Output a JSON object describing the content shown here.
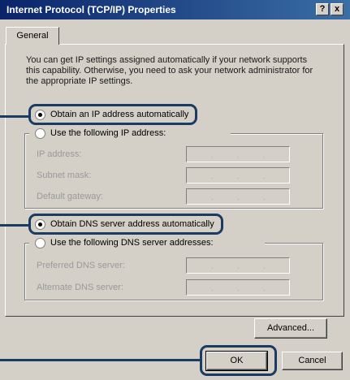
{
  "window": {
    "title": "Internet Protocol (TCP/IP) Properties",
    "help_button": "?",
    "close_button": "x"
  },
  "tab": {
    "label": "General"
  },
  "description": "You can get IP settings assigned automatically if your network supports this capability. Otherwise, you need to ask your network administrator for the appropriate IP settings.",
  "ip_group": {
    "auto_label": "Obtain an IP address automatically",
    "manual_label": "Use the following IP address:",
    "selected": "auto",
    "fields": [
      {
        "label": "IP address:"
      },
      {
        "label": "Subnet mask:"
      },
      {
        "label": "Default gateway:"
      }
    ]
  },
  "dns_group": {
    "auto_label": "Obtain DNS server address automatically",
    "manual_label": "Use the following DNS server addresses:",
    "selected": "auto",
    "fields": [
      {
        "label": "Preferred DNS server:"
      },
      {
        "label": "Alternate DNS server:"
      }
    ]
  },
  "buttons": {
    "advanced": "Advanced...",
    "ok": "OK",
    "cancel": "Cancel"
  },
  "colors": {
    "title_bar": "#0a246a",
    "dialog_face": "#d4d0c8",
    "callout": "#1a3b62"
  }
}
